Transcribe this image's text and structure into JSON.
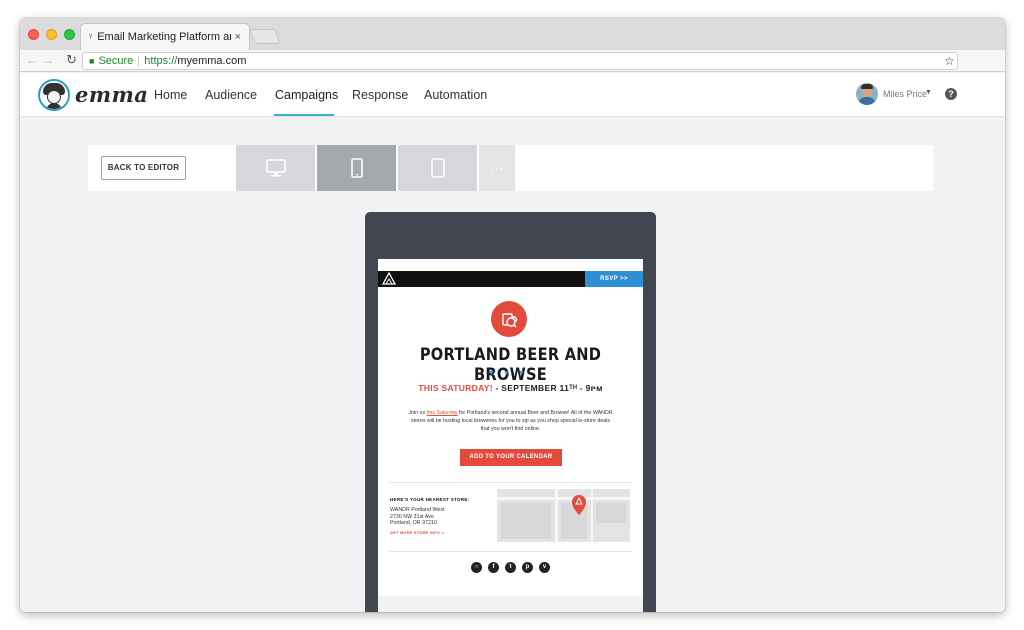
{
  "browser": {
    "tab_title": "Email Marketing Platform and",
    "tab_icon": "glasses-icon",
    "tab_close": "×",
    "address_secure": "Secure",
    "address_scheme": "https://",
    "address_host": "myemma.com"
  },
  "app": {
    "logo_text": "emma",
    "nav": [
      {
        "label": "Home"
      },
      {
        "label": "Audience"
      },
      {
        "label": "Campaigns",
        "active": true
      },
      {
        "label": "Response"
      },
      {
        "label": "Automation"
      }
    ],
    "user_name": "Miles Price",
    "help_label": "?",
    "accent_color": "#3ab0d8"
  },
  "preview": {
    "back_label": "BACK TO EDITOR",
    "devices": [
      {
        "name": "desktop",
        "icon": "monitor-icon"
      },
      {
        "name": "phone",
        "icon": "phone-icon",
        "selected": true
      },
      {
        "name": "tablet",
        "icon": "tablet-icon"
      },
      {
        "name": "more",
        "icon": "ellipsis-icon",
        "label": "···"
      }
    ]
  },
  "email": {
    "rsvp_label": "RSVP >>",
    "title": "PORTLAND BEER AND BROWSE",
    "arrows": "▼▼▼",
    "date_highlight": "THIS SATURDAY!",
    "date_rest": " - SEPTEMBER 11ᵀᴴ - 9ᴘᴍ",
    "body_prefix": "Join us ",
    "body_link": "this Saturday",
    "body_suffix": " for Portland's second annual Beer and Browse! All of the WANDR stores will be hosting local breweries for you to sip as you shop special in-store deals that you won't find online.",
    "calendar_label": "ADD TO YOUR CALENDAR",
    "store_heading": "HERE'S YOUR NEAREST STORE:",
    "store_name": "WANDR Portland West",
    "store_street": "2730 NW 31st Ave",
    "store_city": "Portland, OR 97210",
    "store_link": "GET MORE STORE INFO »",
    "socials": [
      "instagram-icon",
      "facebook-icon",
      "twitter-icon",
      "pinterest-icon",
      "vimeo-icon"
    ],
    "brand_color": "#e24b3c",
    "rsvp_color": "#2f8fd6"
  }
}
